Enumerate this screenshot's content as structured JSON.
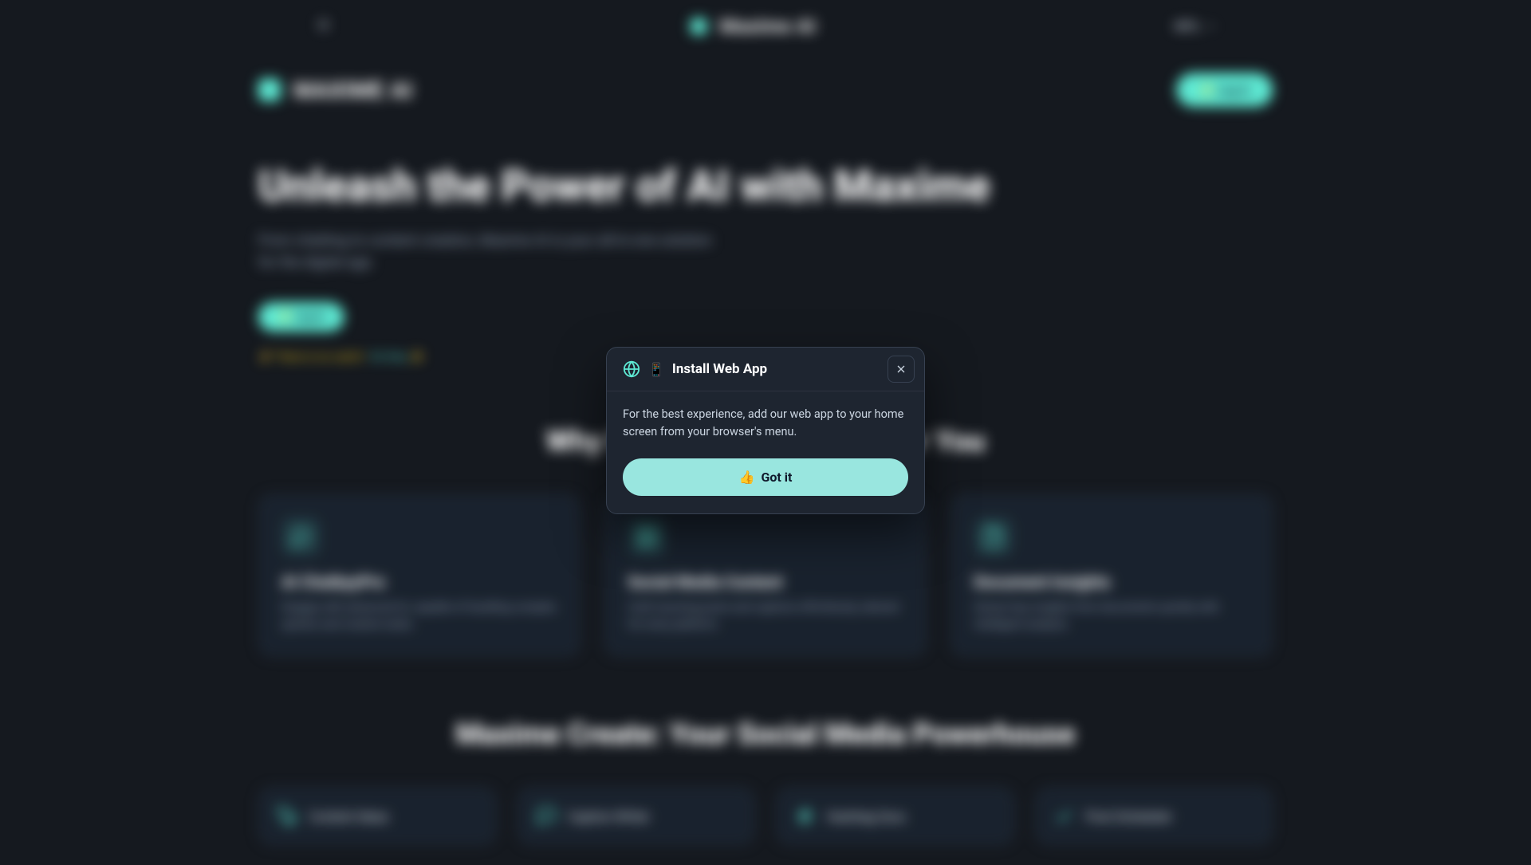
{
  "topbar": {
    "brand": "Maxime AI",
    "lang": "INTL"
  },
  "secondbar": {
    "brand": "MAXIME AI",
    "login": "✨ Log in"
  },
  "hero": {
    "title": "Unleash the Power of AI with Maxime",
    "sub": "From chatting to content creation, Maxime AI is your all-in-one solution for the digital age.",
    "cta": "✨ Log in",
    "catch_pre": "⚡ There is no catch!",
    "catch_link": "It's free ✨"
  },
  "section1_title": "Why Maxime AI is Perfect for You",
  "cards": [
    {
      "title": "AI ChatbyyPro",
      "desc": "Engage with advanced AI, capable of handling complex queries and creative tasks."
    },
    {
      "title": "Social Media Content",
      "desc": "Craft stunning posts and captions effortlessly, tailored for every platform."
    },
    {
      "title": "Document Insights",
      "desc": "Extract key insights from documents quickly with intelligent analysis."
    }
  ],
  "section2_title": "Maxime Create: Your Social Media Powerhouse",
  "minis": [
    "Content Ideas",
    "Caption Writer",
    "Hashtag Guru",
    "Post Scheduler"
  ],
  "modal": {
    "emoji": "📱",
    "title": "Install Web App",
    "body": "For the best experience, add our web app to your home screen from your browser's menu.",
    "btn": "Got it",
    "btn_emoji": "👍"
  }
}
